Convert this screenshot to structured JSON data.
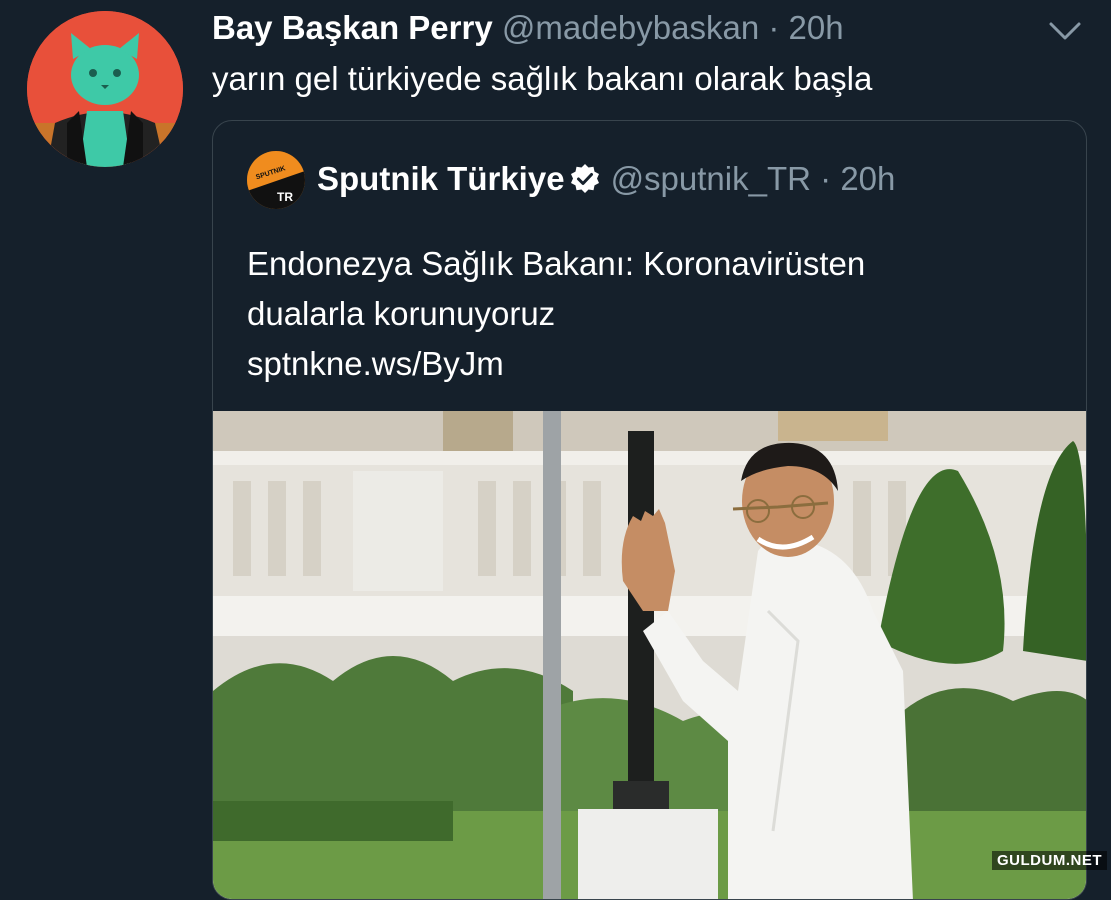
{
  "tweet": {
    "display_name": "Bay Başkan Perry",
    "handle": "@madebybaskan",
    "separator": "·",
    "time": "20h",
    "text": "yarın gel türkiyede sağlık bakanı olarak başla",
    "menu_icon": "chevron-down-icon",
    "avatar_icon": "cat-avatar-icon"
  },
  "quoted": {
    "display_name": "Sputnik Türkiye",
    "verified_icon": "verified-badge-icon",
    "handle": "@sputnik_TR",
    "separator": "·",
    "time": "20h",
    "text_lines": [
      "Endonezya Sağlık Bakanı: Koronavirüsten",
      "dualarla korunuyoruz"
    ],
    "link": "sptnkne.ws/ByJm",
    "avatar": {
      "badge_top": "SPUTNIK",
      "badge_bottom": "TR"
    },
    "photo": {
      "description_icon": "news-photo"
    }
  },
  "watermark": "GULDUM.NET",
  "colors": {
    "background": "#15202b",
    "border": "#38444d",
    "secondary_text": "#8899a6",
    "avatar_bg": "#e8503a",
    "sputnik_orange": "#f08c1e"
  }
}
